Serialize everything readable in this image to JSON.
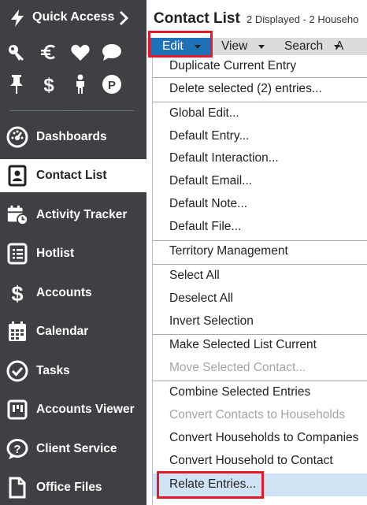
{
  "sidebar": {
    "quick_access_label": "Quick Access",
    "quick_icons": [
      "key-icon",
      "euro-icon",
      "heart-icon",
      "chat-icon",
      "pin-icon",
      "dollar-icon",
      "person-icon",
      "p-circle-icon"
    ],
    "items": [
      {
        "label": "Dashboards",
        "icon": "dashboard-icon",
        "active": false
      },
      {
        "label": "Contact List",
        "icon": "contact-card-icon",
        "active": true
      },
      {
        "label": "Activity Tracker",
        "icon": "calendar-clock-icon",
        "active": false
      },
      {
        "label": "Hotlist",
        "icon": "list-icon",
        "active": false
      },
      {
        "label": "Accounts",
        "icon": "dollar-icon",
        "active": false
      },
      {
        "label": "Calendar",
        "icon": "calendar-icon",
        "active": false
      },
      {
        "label": "Tasks",
        "icon": "check-circle-icon",
        "active": false
      },
      {
        "label": "Accounts Viewer",
        "icon": "viewer-icon",
        "active": false
      },
      {
        "label": "Client Service",
        "icon": "question-bubble-icon",
        "active": false
      },
      {
        "label": "Office Files",
        "icon": "file-icon",
        "active": false
      }
    ]
  },
  "main": {
    "title": "Contact List",
    "subtitle": "2 Displayed - 2 Househo",
    "menubar": {
      "edit": "Edit",
      "view": "View",
      "search": "Search",
      "more": "A"
    }
  },
  "menu": {
    "items": [
      {
        "label": "Duplicate Current Entry",
        "disabled": false
      },
      {
        "label": "Delete selected (2) entries...",
        "disabled": false
      },
      {
        "label": "Global Edit...",
        "disabled": false
      },
      {
        "label": "Default Entry...",
        "disabled": false
      },
      {
        "label": "Default Interaction...",
        "disabled": false
      },
      {
        "label": "Default Email...",
        "disabled": false
      },
      {
        "label": "Default Note...",
        "disabled": false
      },
      {
        "label": "Default File...",
        "disabled": false
      },
      {
        "label": "Territory Management",
        "disabled": false
      },
      {
        "label": "Select All",
        "disabled": false
      },
      {
        "label": "Deselect All",
        "disabled": false
      },
      {
        "label": "Invert Selection",
        "disabled": false
      },
      {
        "label": "Make Selected List Current",
        "disabled": false
      },
      {
        "label": "Move Selected Contact...",
        "disabled": true
      },
      {
        "label": "Combine Selected Entries",
        "disabled": false
      },
      {
        "label": "Convert Contacts to Households",
        "disabled": true
      },
      {
        "label": "Convert Households to Companies",
        "disabled": false
      },
      {
        "label": "Convert Household to Contact",
        "disabled": false
      },
      {
        "label": "Relate Entries...",
        "disabled": false,
        "highlighted": true
      }
    ]
  },
  "colors": {
    "sidebar_bg": "#3e4043",
    "menu_active": "#1f71b8",
    "highlight": "#d0e3f4",
    "annotation": "#e21b2a"
  }
}
